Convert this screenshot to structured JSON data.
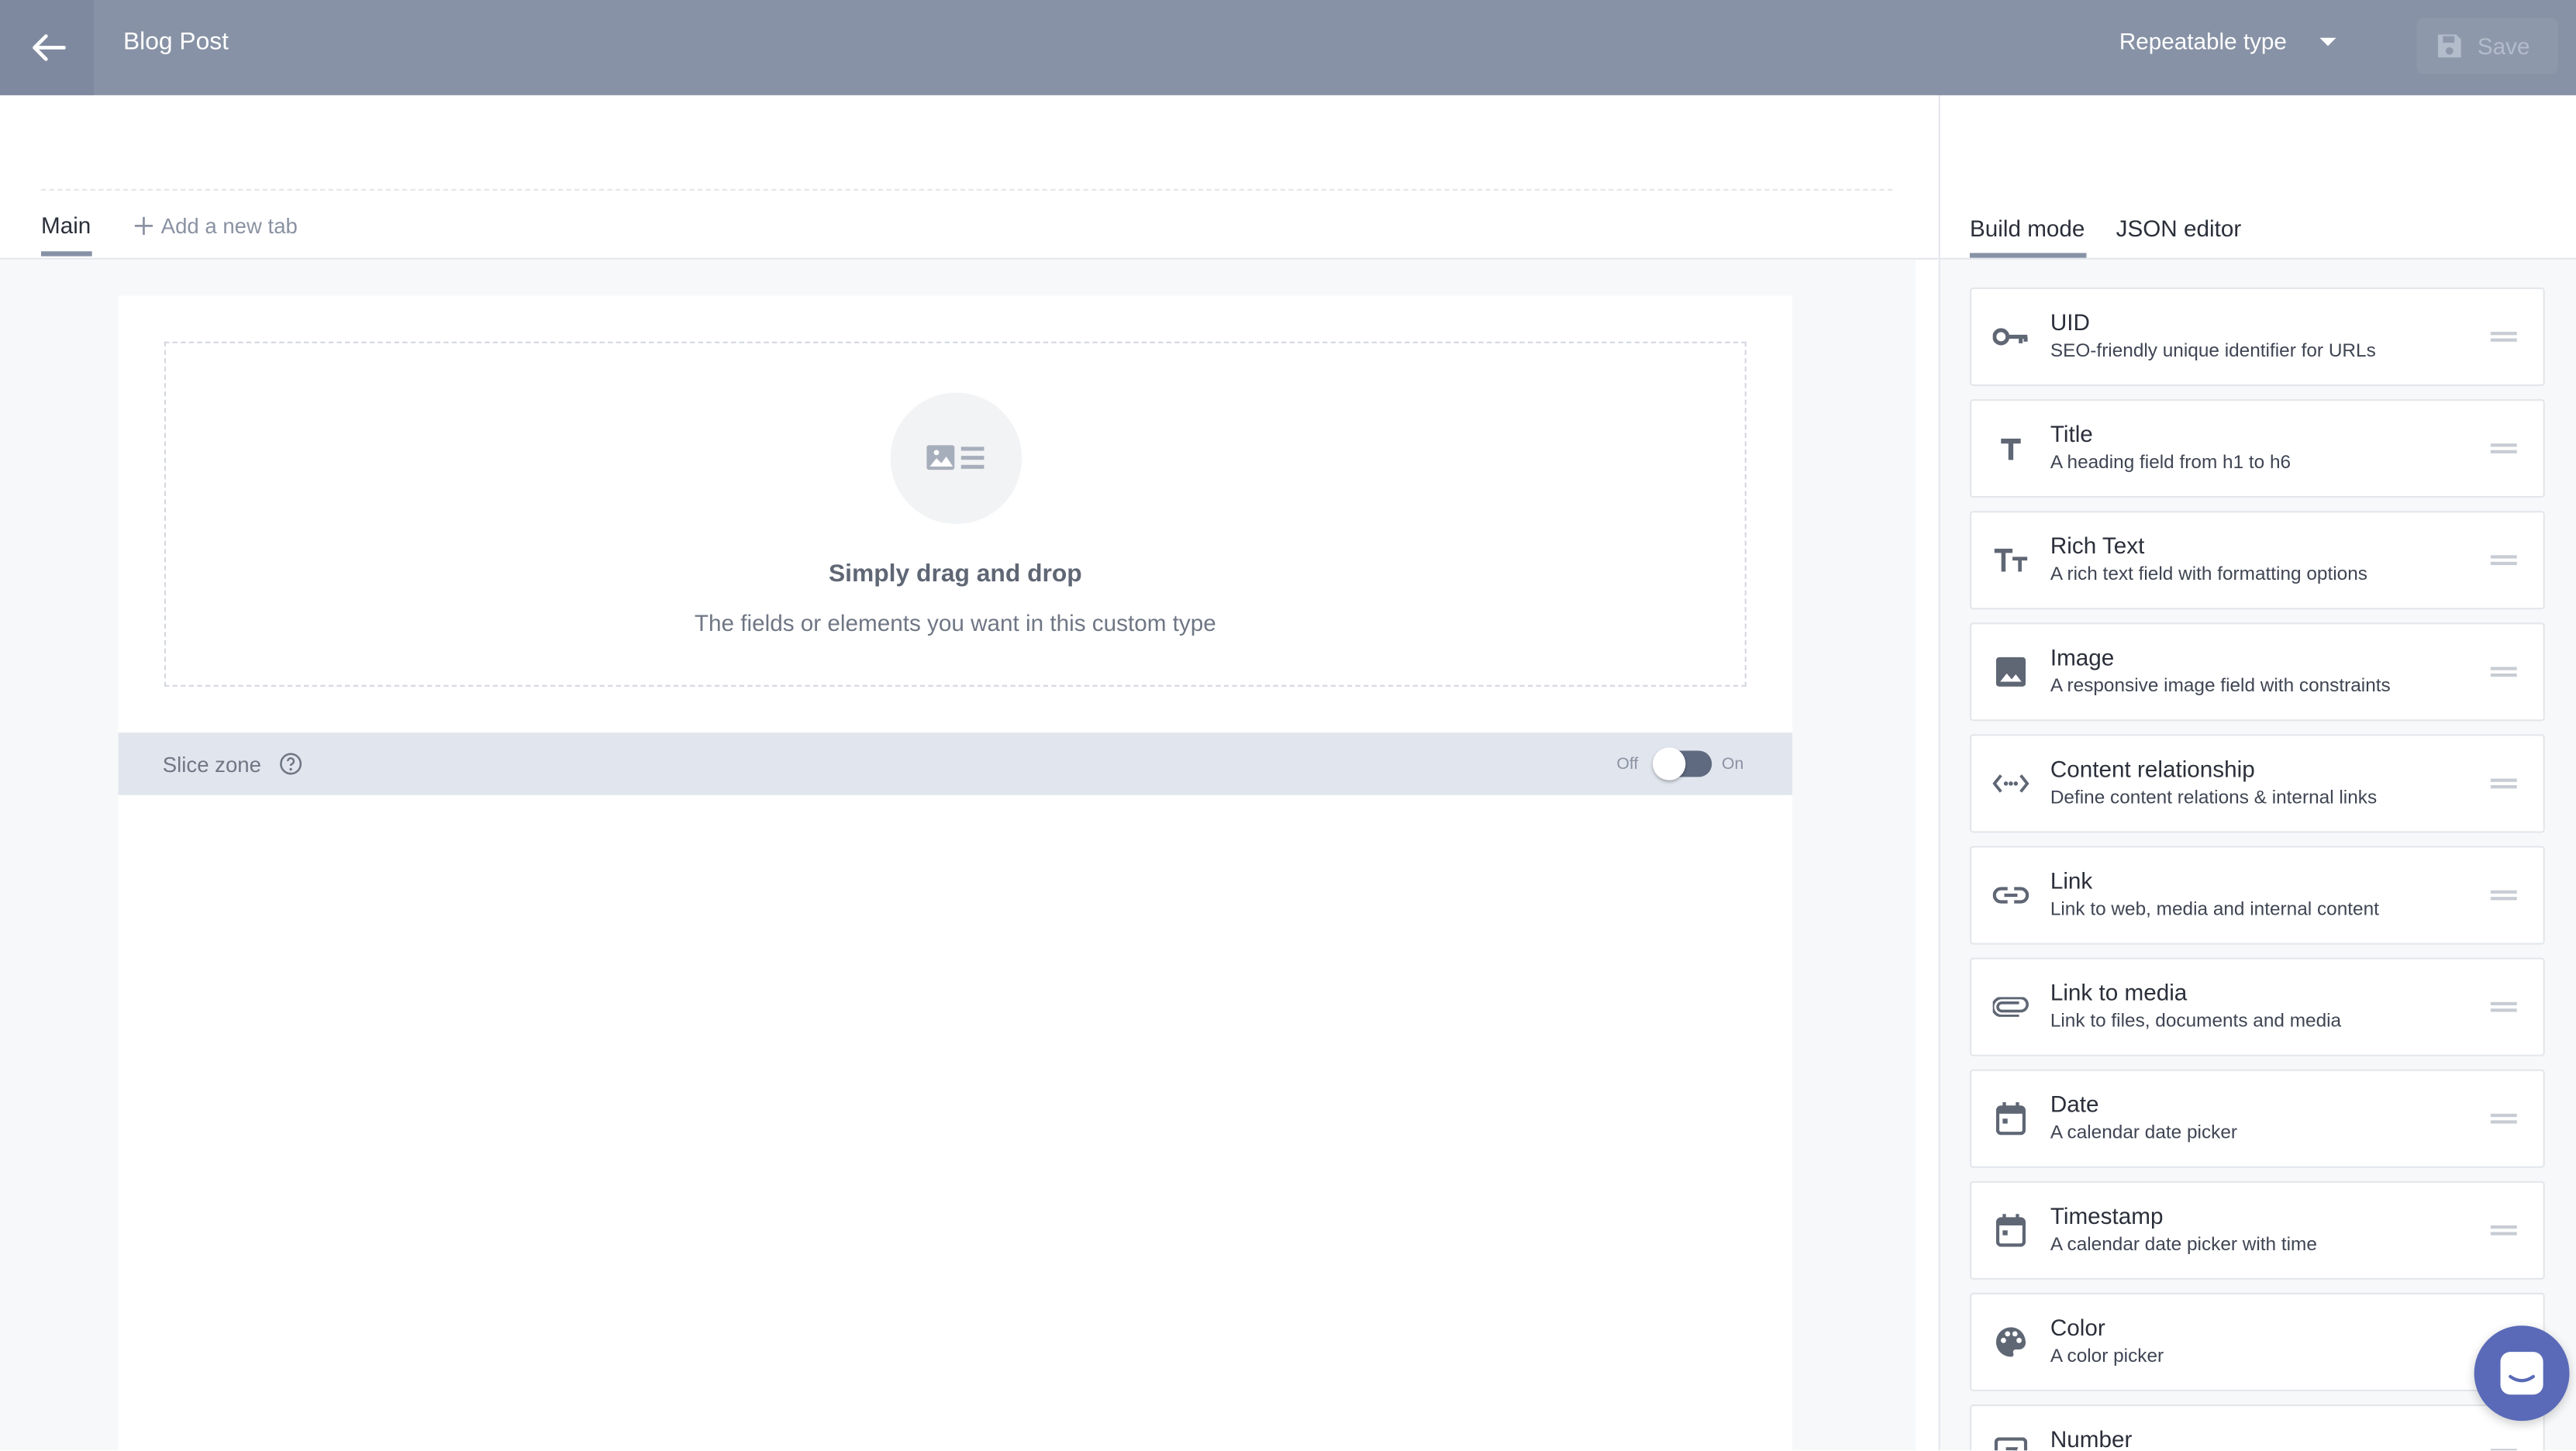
{
  "header": {
    "title": "Blog Post",
    "type_select": "Repeatable type",
    "save_label": "Save"
  },
  "tabs": {
    "main_label": "Main",
    "add_tab_label": "Add a new tab"
  },
  "dropzone": {
    "title": "Simply drag and drop",
    "subtitle": "The fields or elements you want in this custom type"
  },
  "slice_zone": {
    "label": "Slice zone",
    "off_label": "Off",
    "on_label": "On"
  },
  "sidebar": {
    "build_mode": "Build mode",
    "json_editor": "JSON editor",
    "fields": [
      {
        "name": "UID",
        "desc": "SEO-friendly unique identifier for URLs",
        "icon": "key-icon"
      },
      {
        "name": "Title",
        "desc": "A heading field from h1 to h6",
        "icon": "title-icon"
      },
      {
        "name": "Rich Text",
        "desc": "A rich text field with formatting options",
        "icon": "rich-text-icon"
      },
      {
        "name": "Image",
        "desc": "A responsive image field with constraints",
        "icon": "image-icon"
      },
      {
        "name": "Content relationship",
        "desc": "Define content relations & internal links",
        "icon": "relationship-icon"
      },
      {
        "name": "Link",
        "desc": "Link to web, media and internal content",
        "icon": "link-icon"
      },
      {
        "name": "Link to media",
        "desc": "Link to files, documents and media",
        "icon": "paperclip-icon"
      },
      {
        "name": "Date",
        "desc": "A calendar date picker",
        "icon": "calendar-icon"
      },
      {
        "name": "Timestamp",
        "desc": "A calendar date picker with time",
        "icon": "calendar-icon"
      },
      {
        "name": "Color",
        "desc": "A color picker",
        "icon": "palette-icon"
      },
      {
        "name": "Number",
        "desc": "",
        "icon": "number-icon"
      }
    ]
  }
}
